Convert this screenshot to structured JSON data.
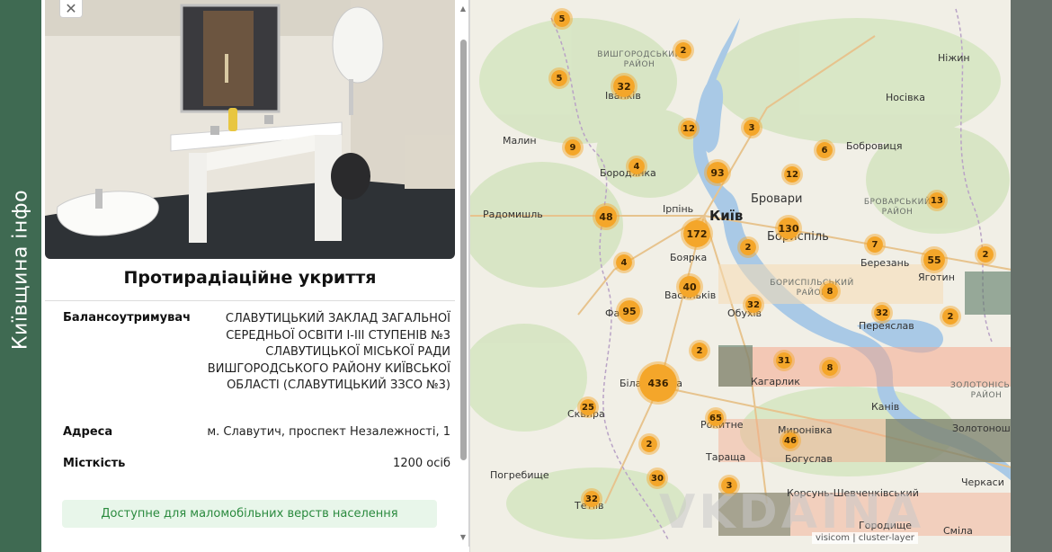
{
  "brand": {
    "name": "Київщина інфо"
  },
  "popup": {
    "close_icon": "close-icon",
    "title": "Протирадіаційне укриття",
    "owner_label": "Балансоутримувач",
    "owner_value": "СЛАВУТИЦЬКИЙ ЗАКЛАД ЗАГАЛЬНОЇ СЕРЕДНЬОЇ ОСВІТИ І-ІІІ СТУПЕНІВ №3 СЛАВУТИЦЬКОЇ МІСЬКОЇ РАДИ ВИШГОРОДСЬКОГО РАЙОНУ КИЇВСЬКОЇ ОБЛАСТІ (СЛАВУТИЦЬКИЙ ЗЗСО №3)",
    "address_label": "Адреса",
    "address_value": "м. Славутич, проспект Незалежності, 1",
    "capacity_label": "Місткість",
    "capacity_value": "1200 осіб",
    "accessibility_badge": "Доступне для маломобільних верств населення",
    "scroll_up_icon": "▲",
    "scroll_down_icon": "▼"
  },
  "map": {
    "places": [
      {
        "id": "nizhyn",
        "name": "Ніжин"
      },
      {
        "id": "nosivka",
        "name": "Носівка"
      },
      {
        "id": "malyn",
        "name": "Малин"
      },
      {
        "id": "ivankiv",
        "name": "Іванків"
      },
      {
        "id": "borodianka",
        "name": "Бородянка"
      },
      {
        "id": "bobrovytsia",
        "name": "Бобровиця"
      },
      {
        "id": "radomyshl",
        "name": "Радомишль"
      },
      {
        "id": "irpin",
        "name": "Ірпінь"
      },
      {
        "id": "kyiv",
        "name": "Київ"
      },
      {
        "id": "brovary",
        "name": "Бровари"
      },
      {
        "id": "boryspil",
        "name": "Бориспіль"
      },
      {
        "id": "boiarka",
        "name": "Боярка"
      },
      {
        "id": "berezan",
        "name": "Березань"
      },
      {
        "id": "yahotyn",
        "name": "Яготин"
      },
      {
        "id": "vasylkiv",
        "name": "Васильків"
      },
      {
        "id": "fastiv",
        "name": "Фастів"
      },
      {
        "id": "obukhiv",
        "name": "Обухів"
      },
      {
        "id": "pereiaslav",
        "name": "Переяслав"
      },
      {
        "id": "kaharlyk",
        "name": "Кагарлик"
      },
      {
        "id": "bila_tserkva",
        "name": "Біла Церква"
      },
      {
        "id": "skvyra",
        "name": "Сквира"
      },
      {
        "id": "kaniv",
        "name": "Канів"
      },
      {
        "id": "rokytne",
        "name": "Рокитне"
      },
      {
        "id": "myronivka",
        "name": "Миронівка"
      },
      {
        "id": "zolotonosha",
        "name": "Золотоноша"
      },
      {
        "id": "tarashcha",
        "name": "Тараща"
      },
      {
        "id": "bohuslav",
        "name": "Богуслав"
      },
      {
        "id": "pohrebyshche",
        "name": "Погребище"
      },
      {
        "id": "korsun",
        "name": "Корсунь-Шевченківський"
      },
      {
        "id": "cherkasy",
        "name": "Черкаси"
      },
      {
        "id": "horodyshche",
        "name": "Городище"
      },
      {
        "id": "smila",
        "name": "Сміла"
      },
      {
        "id": "tetiiv",
        "name": "Тетіїв"
      }
    ],
    "districts": [
      {
        "id": "vyshhorod",
        "name": "ВИШГОРОДСЬКИЙ РАЙОН"
      },
      {
        "id": "brovary_d",
        "name": "БРОВАРСЬКИЙ РАЙОН"
      },
      {
        "id": "boryspil_d",
        "name": "БОРИСПІЛЬСЬКИЙ РАЙОН"
      },
      {
        "id": "zolotonosha_d",
        "name": "ЗОЛОТОНІСЬКИЙ РАЙОН"
      }
    ],
    "clusters": [
      {
        "count": "5"
      },
      {
        "count": "2"
      },
      {
        "count": "5"
      },
      {
        "count": "32"
      },
      {
        "count": "12"
      },
      {
        "count": "3"
      },
      {
        "count": "9"
      },
      {
        "count": "4"
      },
      {
        "count": "93"
      },
      {
        "count": "12"
      },
      {
        "count": "6"
      },
      {
        "count": "13"
      },
      {
        "count": "48"
      },
      {
        "count": "172"
      },
      {
        "count": "130"
      },
      {
        "count": "2"
      },
      {
        "count": "7"
      },
      {
        "count": "55"
      },
      {
        "count": "2"
      },
      {
        "count": "4"
      },
      {
        "count": "40"
      },
      {
        "count": "32"
      },
      {
        "count": "8"
      },
      {
        "count": "95"
      },
      {
        "count": "32"
      },
      {
        "count": "2"
      },
      {
        "count": "2"
      },
      {
        "count": "31"
      },
      {
        "count": "8"
      },
      {
        "count": "436"
      },
      {
        "count": "25"
      },
      {
        "count": "65"
      },
      {
        "count": "46"
      },
      {
        "count": "2"
      },
      {
        "count": "30"
      },
      {
        "count": "3"
      },
      {
        "count": "32"
      }
    ],
    "attribution": "visicom | cluster-layer",
    "watermark": "VKDAINA",
    "colors": {
      "cluster": "#f4a62a",
      "water": "#a9c9e6",
      "land": "#f1efe6",
      "brand_band": "#3f6a52"
    }
  }
}
